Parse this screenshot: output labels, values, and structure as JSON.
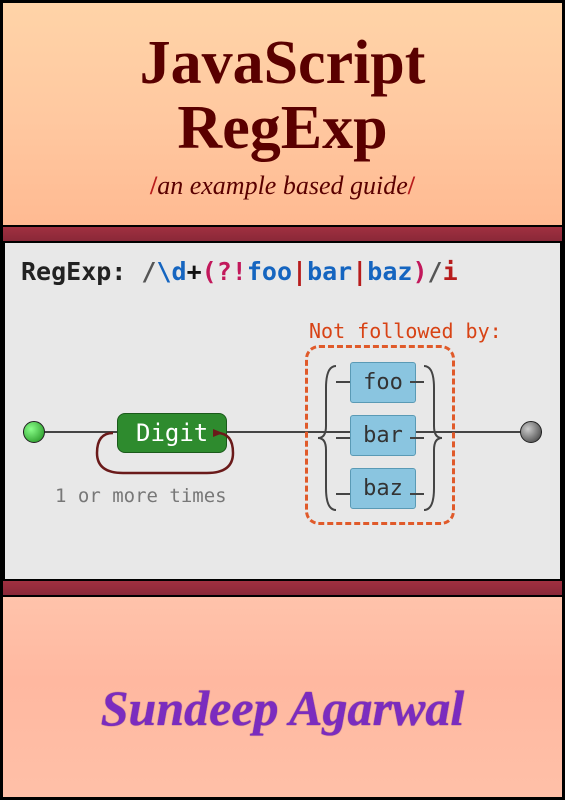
{
  "title_line1": "JavaScript",
  "title_line2": "RegExp",
  "subtitle_text": "an example based guide",
  "slash": "/",
  "regexp": {
    "label": "RegExp:",
    "open_slash": "/",
    "escape": "\\d",
    "plus": "+",
    "open_paren": "(",
    "quest": "?",
    "bang": "!",
    "w1": "foo",
    "pipe": "|",
    "w2": "bar",
    "w3": "baz",
    "close_paren": ")",
    "close_slash": "/",
    "flag": "i"
  },
  "diagram": {
    "not_followed": "Not followed by:",
    "digit": "Digit",
    "loop_label": "1 or more times",
    "alts": [
      "foo",
      "bar",
      "baz"
    ]
  },
  "author": "Sundeep Agarwal"
}
